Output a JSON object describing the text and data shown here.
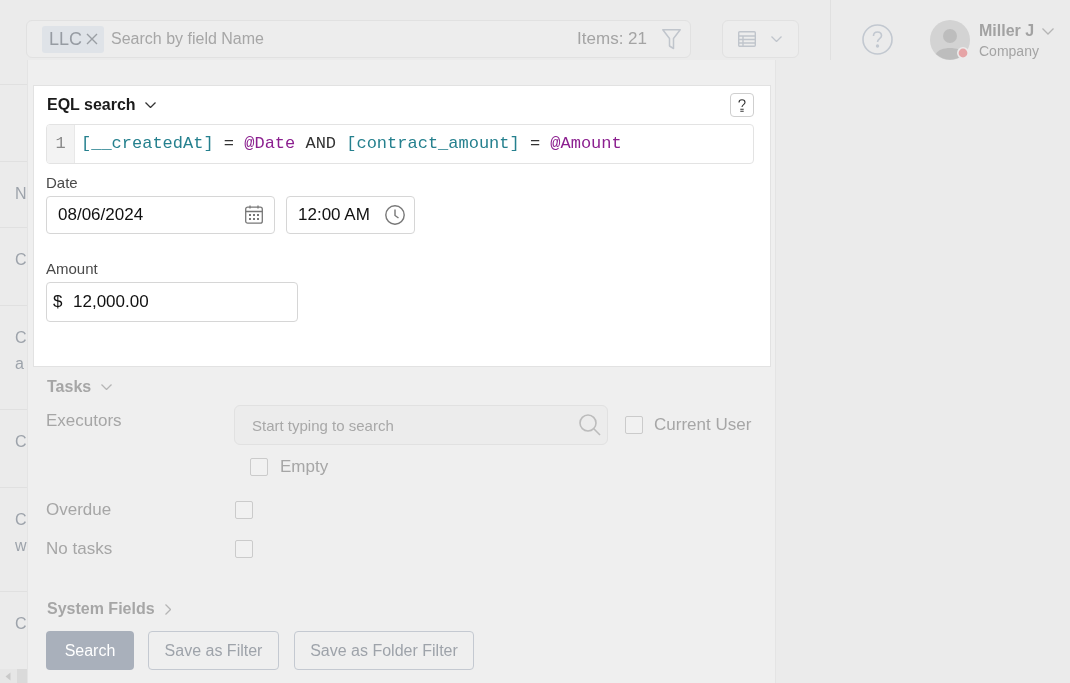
{
  "header": {
    "search": {
      "tags": [
        {
          "label": "LLC"
        }
      ],
      "placeholder": "Search by field Name",
      "items_count": "Items: 21"
    },
    "user": {
      "name": "Miller J",
      "company": "Company"
    }
  },
  "table": {
    "column_1": "N",
    "rows": [
      [
        "C"
      ],
      [
        "C",
        "a"
      ],
      [
        "C"
      ],
      [
        "C",
        "w"
      ],
      [
        "C"
      ]
    ]
  },
  "eql_search": {
    "title": "EQL search",
    "expanded": true,
    "line_number": "1",
    "query": [
      {
        "kind": "field",
        "text": "[__createdAt]"
      },
      {
        "kind": "operator",
        "text": "="
      },
      {
        "kind": "param",
        "text": "@Date"
      },
      {
        "kind": "keyword",
        "text": "AND"
      },
      {
        "kind": "field",
        "text": "[contract_amount]"
      },
      {
        "kind": "operator",
        "text": "="
      },
      {
        "kind": "param",
        "text": "@Amount"
      }
    ],
    "params": [
      {
        "kind": "datetime",
        "label": "Date",
        "date": "08/06/2024",
        "time": "12:00 AM"
      },
      {
        "kind": "money",
        "label": "Amount",
        "currency": "$",
        "value": "12,000.00"
      }
    ]
  },
  "tasks": {
    "title": "Tasks",
    "expanded": true,
    "executors": {
      "label": "Executors",
      "placeholder": "Start typing to search",
      "current_user": {
        "label": "Current User",
        "checked": false
      },
      "empty": {
        "label": "Empty",
        "checked": false
      }
    },
    "overdue": {
      "label": "Overdue",
      "checked": false
    },
    "no_tasks": {
      "label": "No tasks",
      "checked": false
    }
  },
  "system_fields": {
    "title": "System Fields",
    "expanded": false
  },
  "buttons": [
    {
      "label": "Search",
      "primary": true
    },
    {
      "label": "Save as Filter",
      "primary": false
    },
    {
      "label": "Save as Folder Filter",
      "primary": false
    }
  ]
}
